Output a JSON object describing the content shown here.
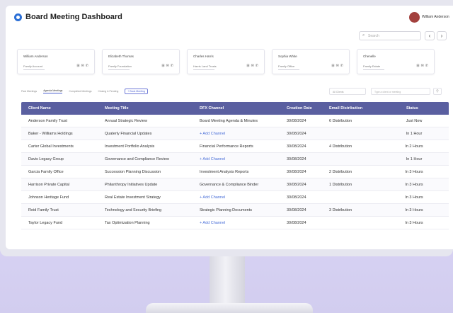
{
  "app": {
    "title": "Board Meeting Dashboard",
    "user_name": "William Anderson"
  },
  "search": {
    "placeholder": "Search"
  },
  "nav": {
    "prev": "‹",
    "next": "›"
  },
  "cards": [
    {
      "name": "William Anderson",
      "subtitle": "Family Account"
    },
    {
      "name": "Elizabeth Thomas",
      "subtitle": "Family Foundation"
    },
    {
      "name": "Charles Harris",
      "subtitle": "Harris Land Trusts"
    },
    {
      "name": "Sophia White",
      "subtitle": "Family Office"
    },
    {
      "name": "Chenelle",
      "subtitle": "Family Estate"
    }
  ],
  "tabs": {
    "items": [
      "Past Meetings",
      "Agenda Meetings",
      "Completed Meetings",
      "Closing & Pending"
    ],
    "active_index": 1,
    "add_button": "+ Book Meeting"
  },
  "filter": {
    "placeholder": "All Clients"
  },
  "table_search": {
    "placeholder": "Type a client or meeting"
  },
  "table": {
    "headers": [
      "Client Name",
      "Meeting Title",
      "DFX Channel",
      "Creation Date",
      "Email Distribution",
      "Status"
    ],
    "rows": [
      {
        "client": "Anderson Family Trust",
        "title": "Annual Strategic Review",
        "channel": "Board Meeting Agenda & Minutes",
        "channel_link": false,
        "date": "30/08/2024",
        "email": "6 Distribution",
        "status": "Just Now"
      },
      {
        "client": "Baker - Williams Holdings",
        "title": "Quaterly Financial Updates",
        "channel": "+ Add Channel",
        "channel_link": true,
        "date": "30/08/2024",
        "email": "",
        "status": "In 1 Hour"
      },
      {
        "client": "Carter Global Investments",
        "title": "Investment Portfolio Analysis",
        "channel": "Financial Performance Reports",
        "channel_link": false,
        "date": "30/08/2024",
        "email": "4 Distribution",
        "status": "In 2 Hours"
      },
      {
        "client": "Davis Legacy Group",
        "title": "Governance and Compliance Review",
        "channel": "+ Add Channel",
        "channel_link": true,
        "date": "30/08/2024",
        "email": "",
        "status": "In 1 Hour"
      },
      {
        "client": "Garcia Family Office",
        "title": "Succession Planning Discussion",
        "channel": "Investment Analysis Reports",
        "channel_link": false,
        "date": "30/08/2024",
        "email": "2 Distribution",
        "status": "In 3 Hours"
      },
      {
        "client": "Harrison Private Capital",
        "title": "Philanthropy Initiatives Update",
        "channel": "Governance & Compliance Binder",
        "channel_link": false,
        "date": "30/08/2024",
        "email": "1 Distribution",
        "status": "In 3 Hours"
      },
      {
        "client": "Johnson Heritage Fund",
        "title": "Real Estate Investment Strategy",
        "channel": "+ Add Channel",
        "channel_link": true,
        "date": "30/08/2024",
        "email": "",
        "status": "In 3 Hours"
      },
      {
        "client": "Reid Family Trust",
        "title": "Technology and Security Briefing",
        "channel": "Strategic Planning Documents",
        "channel_link": false,
        "date": "30/08/2024",
        "email": "3 Distribution",
        "status": "In 3 Hours"
      },
      {
        "client": "Taylor Legacy Fund",
        "title": "Tax Optimization Planning",
        "channel": "+ Add Channel",
        "channel_link": true,
        "date": "30/08/2024",
        "email": "",
        "status": "In 3 Hours"
      }
    ]
  },
  "colors": {
    "header_bg": "#5a5fa0",
    "link": "#4a6fd8",
    "accent": "#2b6fd6",
    "background": "#c9c3ef"
  }
}
